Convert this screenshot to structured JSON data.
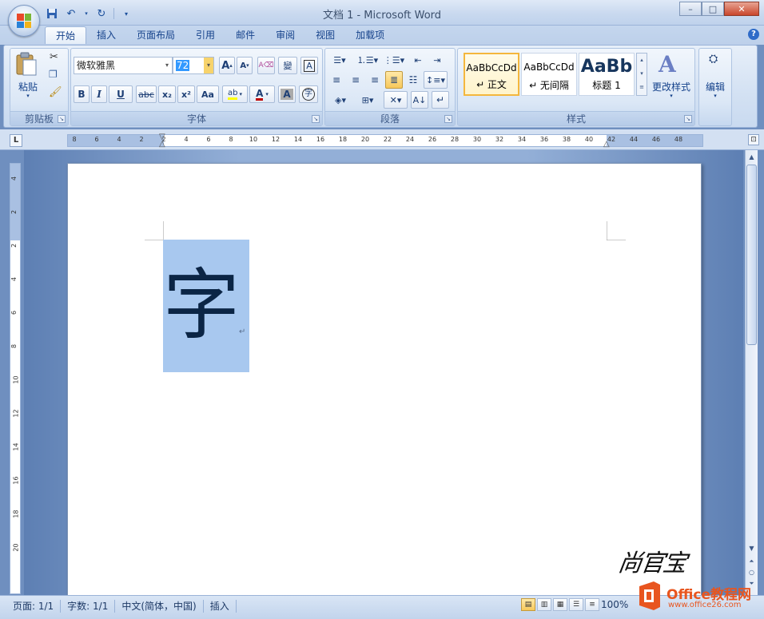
{
  "window": {
    "title": "文档 1 - Microsoft Word",
    "controls": [
      "–",
      "□",
      "✕"
    ]
  },
  "quick_access": [
    "save-icon",
    "undo-icon",
    "redo-icon",
    "customize-icon"
  ],
  "tabs": [
    {
      "label": "开始",
      "active": true
    },
    {
      "label": "插入"
    },
    {
      "label": "页面布局"
    },
    {
      "label": "引用"
    },
    {
      "label": "邮件"
    },
    {
      "label": "审阅"
    },
    {
      "label": "视图"
    },
    {
      "label": "加载项"
    }
  ],
  "ribbon": {
    "clipboard": {
      "label": "剪贴板",
      "paste_label": "粘贴"
    },
    "font": {
      "label": "字体",
      "font_name": "微软雅黑",
      "font_size": "72",
      "buttons": [
        "B",
        "I",
        "U",
        "abc",
        "x₂",
        "x²",
        "Aa",
        "A",
        "A"
      ],
      "grow": "A",
      "shrink": "A",
      "char_a": "A"
    },
    "paragraph": {
      "label": "段落"
    },
    "styles": {
      "label": "样式",
      "tiles": [
        {
          "sample": "AaBbCcDd",
          "name": "↵ 正文"
        },
        {
          "sample": "AaBbCcDd",
          "name": "↵ 无间隔"
        },
        {
          "sample": "AaBb",
          "name": "标题 1"
        }
      ],
      "change_styles": "更改样式"
    },
    "editing": {
      "label": "编辑"
    }
  },
  "ruler": {
    "tab_selector": "L",
    "horizontal_labels": [
      "8",
      "6",
      "4",
      "2",
      "2",
      "4",
      "6",
      "8",
      "10",
      "12",
      "14",
      "16",
      "18",
      "20",
      "22",
      "24",
      "26",
      "28",
      "30",
      "32",
      "34",
      "36",
      "38",
      "40",
      "42",
      "44",
      "46",
      "48"
    ],
    "vertical_labels": [
      "4",
      "2",
      "2",
      "4",
      "6",
      "8",
      "10",
      "12",
      "14",
      "16",
      "18",
      "20"
    ]
  },
  "document": {
    "content": "字",
    "paragraph_mark": "↵",
    "signature": "尚官宝"
  },
  "status": {
    "page": "页面: 1/1",
    "words": "字数: 1/1",
    "language": "中文(简体，中国)",
    "mode": "插入",
    "zoom": "100%"
  },
  "brand": {
    "name": "Office教程网",
    "url": "www.office26.com",
    "colors": {
      "accent": "#e8551f"
    }
  }
}
